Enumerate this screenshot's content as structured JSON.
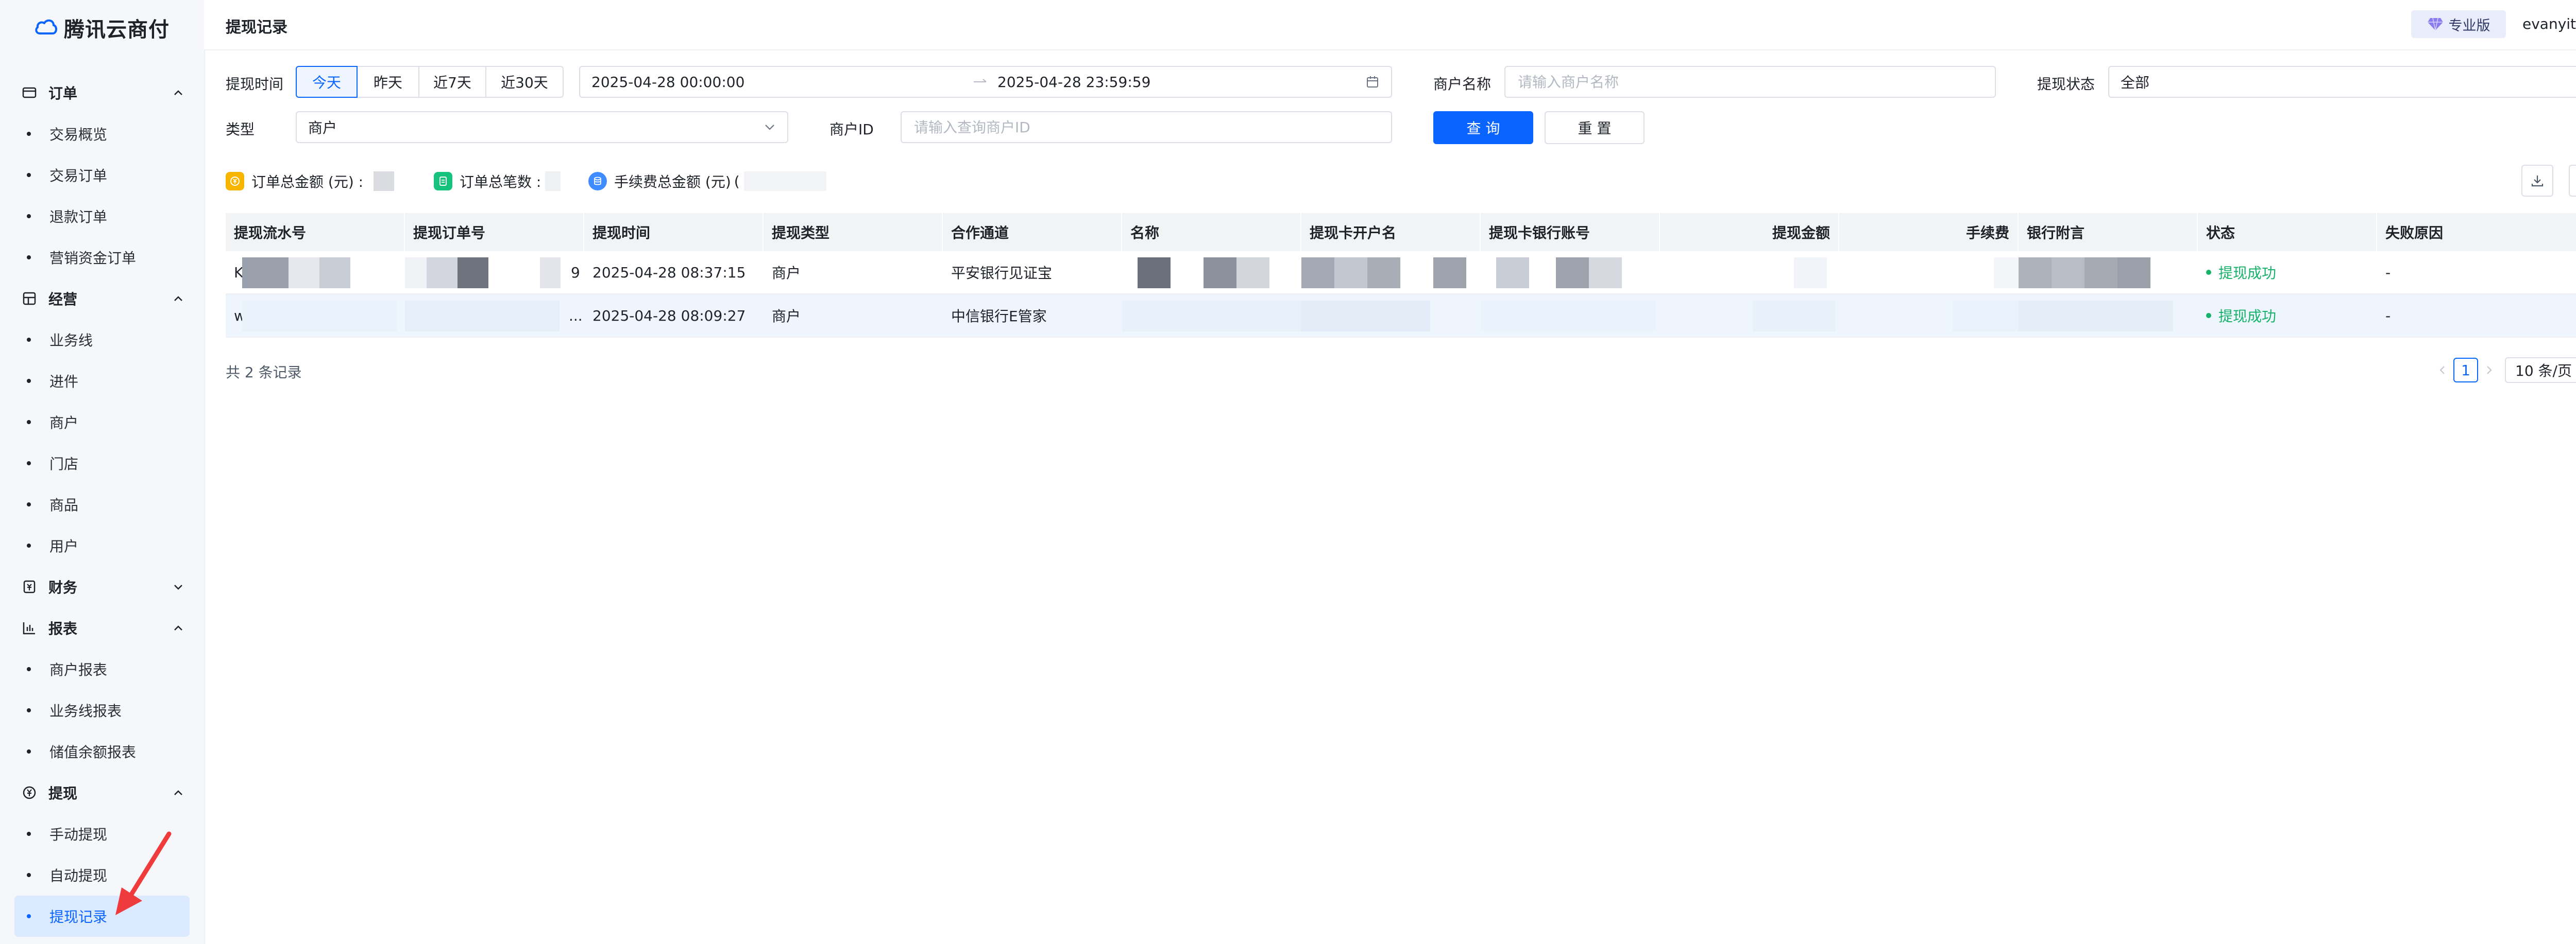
{
  "brand": {
    "name": "腾讯云商付",
    "logo_icon": "cloud-icon",
    "brand_color": "#0a64ff"
  },
  "sidebar": {
    "groups": [
      {
        "label": "订单",
        "icon": "card-icon",
        "expanded": true,
        "items": [
          "交易概览",
          "交易订单",
          "退款订单",
          "营销资金订单"
        ]
      },
      {
        "label": "经营",
        "icon": "grid-icon",
        "expanded": true,
        "items": [
          "业务线",
          "进件",
          "商户",
          "门店",
          "商品",
          "用户"
        ]
      },
      {
        "label": "财务",
        "icon": "finance-icon",
        "expanded": false,
        "items": []
      },
      {
        "label": "报表",
        "icon": "bar-chart-icon",
        "expanded": true,
        "items": [
          "商户报表",
          "业务线报表",
          "储值余额报表"
        ]
      },
      {
        "label": "提现",
        "icon": "yen-circle-icon",
        "expanded": true,
        "items": [
          "手动提现",
          "自动提现",
          "提现记录"
        ]
      }
    ],
    "active_item": "提现记录"
  },
  "header": {
    "title": "提现记录",
    "badge": "专业版",
    "badge_icon": "diamond-icon",
    "user": "evanyitang"
  },
  "filters": {
    "time_label": "提现时间",
    "quick_ranges": [
      "今天",
      "昨天",
      "近7天",
      "近30天"
    ],
    "active_range": "今天",
    "start_time": "2025-04-28 00:00:00",
    "end_time": "2025-04-28 23:59:59",
    "merchant_name_label": "商户名称",
    "merchant_name_placeholder": "请输入商户名称",
    "status_label": "提现状态",
    "status_value": "全部",
    "type_label": "类型",
    "type_value": "商户",
    "merchant_id_label": "商户ID",
    "merchant_id_placeholder": "请输入查询商户ID",
    "query_button": "查 询",
    "reset_button": "重 置"
  },
  "summary": {
    "order_amount_label": "订单总金额 (元) :",
    "order_count_label": "订单总笔数 :",
    "fee_amount_label": "手续费总金额 (元)",
    "fee_amount_partial": "(",
    "colors": {
      "order_amount": "#f7b500",
      "order_count": "#17c27d",
      "fee_amount": "#3d8bff"
    }
  },
  "table": {
    "columns": [
      "提现流水号",
      "提现订单号",
      "提现时间",
      "提现类型",
      "合作通道",
      "名称",
      "提现卡开户名",
      "提现卡银行账号",
      "提现金额",
      "手续费",
      "银行附言",
      "状态",
      "失败原因"
    ],
    "rows": [
      {
        "serial": "K",
        "order_no_tail": "9",
        "time": "2025-04-28 08:37:15",
        "type": "商户",
        "channel": "平安银行见证宝",
        "status": "提现成功",
        "reason": "-"
      },
      {
        "serial": "w",
        "order_no_tail": "...",
        "time": "2025-04-28 08:09:27",
        "type": "商户",
        "channel": "中信银行E管家",
        "status": "提现成功",
        "reason": "-"
      }
    ],
    "status_color": "#17b26a"
  },
  "footer": {
    "total": "共 2 条记录",
    "current_page": "1",
    "page_size": "10 条/页"
  }
}
